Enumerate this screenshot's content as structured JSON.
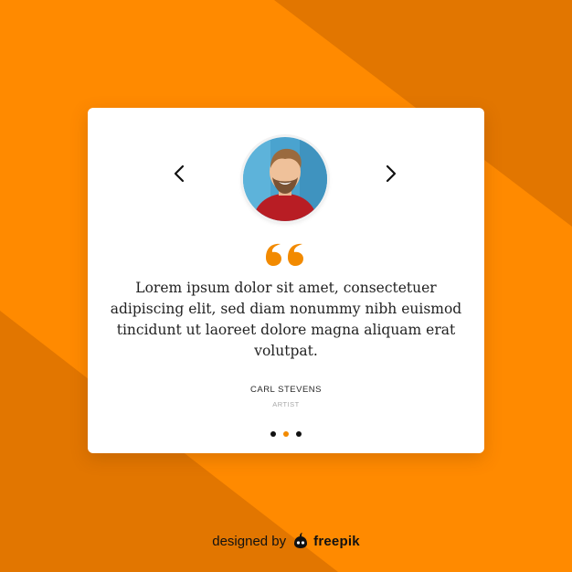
{
  "colors": {
    "background_main": "#FF8A00",
    "background_shade": "#E27600",
    "card": "#FFFFFF",
    "accent": "#F28A00",
    "text": "#222222",
    "muted": "#A8A8A8"
  },
  "carousel": {
    "prev_icon": "chevron-left-icon",
    "next_icon": "chevron-right-icon",
    "quote_icon": "quote-icon",
    "active_index": 1,
    "slide_count": 3
  },
  "testimonial": {
    "text": "Lorem ipsum dolor sit amet, consectetuer adipiscing elit, sed diam nonummy nibh euismod tincidunt ut laoreet dolore magna aliquam erat volutpat.",
    "name": "CARL STEVENS",
    "role": "ARTIST"
  },
  "footer": {
    "prefix": "designed by",
    "brand": "freepik",
    "logo_icon": "freepik-logo-icon"
  }
}
